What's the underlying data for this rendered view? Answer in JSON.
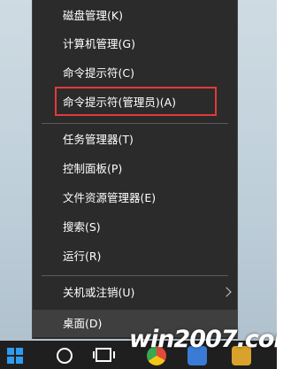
{
  "menu": {
    "items": [
      {
        "label": "磁盘管理(K)"
      },
      {
        "label": "计算机管理(G)"
      },
      {
        "label": "命令提示符(C)"
      },
      {
        "label": "命令提示符(管理员)(A)"
      },
      {
        "label": "任务管理器(T)"
      },
      {
        "label": "控制面板(P)"
      },
      {
        "label": "文件资源管理器(E)"
      },
      {
        "label": "搜索(S)"
      },
      {
        "label": "运行(R)"
      },
      {
        "label": "关机或注销(U)"
      },
      {
        "label": "桌面(D)"
      }
    ]
  },
  "colors": {
    "menu_bg": "#2b2b2b",
    "highlight_outline": "#e23a3a",
    "text": "#ffffff",
    "start_accent": "#2f9cf0"
  },
  "watermark": {
    "text": "win2007.com"
  },
  "icons": {
    "start": "windows-start-icon",
    "cortana": "cortana-circle-icon",
    "taskview": "task-view-icon",
    "submenu": "chevron-right-icon"
  }
}
